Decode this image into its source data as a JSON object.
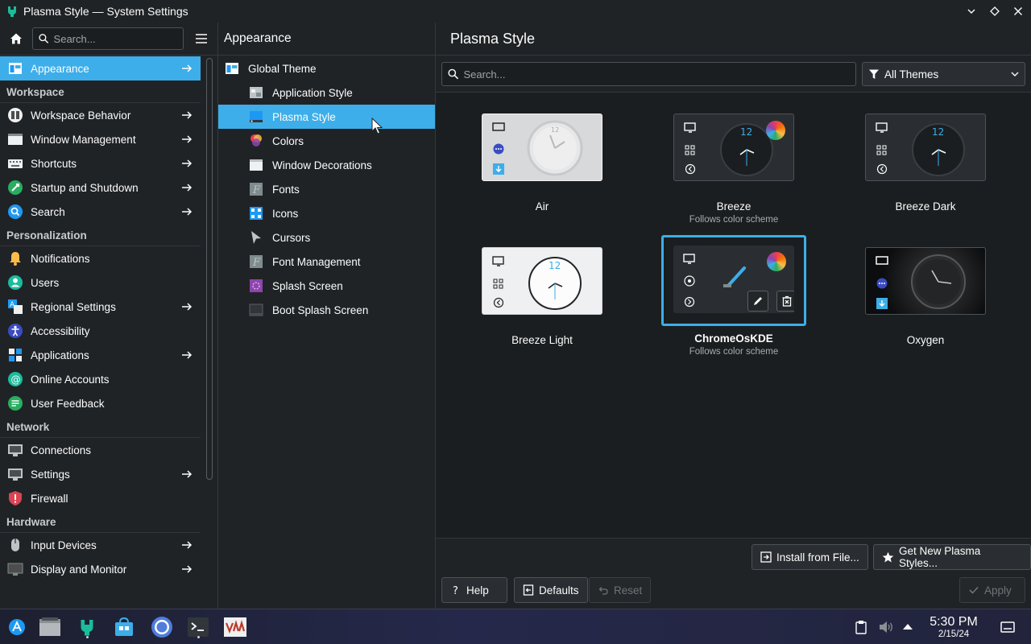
{
  "window": {
    "title": "Plasma Style — System Settings"
  },
  "sidebar": {
    "search_placeholder": "Search...",
    "active": {
      "label": "Appearance"
    },
    "sections": {
      "workspace": "Workspace",
      "personalization": "Personalization",
      "network": "Network",
      "hardware": "Hardware"
    },
    "workspace_items": [
      "Workspace Behavior",
      "Window Management",
      "Shortcuts",
      "Startup and Shutdown",
      "Search"
    ],
    "personalization_items": [
      "Notifications",
      "Users",
      "Regional Settings",
      "Accessibility",
      "Applications",
      "Online Accounts",
      "User Feedback"
    ],
    "network_items": [
      "Connections",
      "Settings",
      "Firewall"
    ],
    "hardware_items": [
      "Input Devices",
      "Display and Monitor"
    ]
  },
  "appearance": {
    "header": "Appearance",
    "items": [
      "Global Theme",
      "Application Style",
      "Plasma Style",
      "Colors",
      "Window Decorations",
      "Fonts",
      "Icons",
      "Cursors",
      "Font Management",
      "Splash Screen",
      "Boot Splash Screen"
    ]
  },
  "main": {
    "header": "Plasma Style",
    "search_placeholder": "Search...",
    "filter_label": "All Themes",
    "themes": [
      {
        "name": "Air",
        "sub": ""
      },
      {
        "name": "Breeze",
        "sub": "Follows color scheme"
      },
      {
        "name": "Breeze Dark",
        "sub": ""
      },
      {
        "name": "Breeze Light",
        "sub": ""
      },
      {
        "name": "ChromeOsKDE",
        "sub": "Follows color scheme"
      },
      {
        "name": "Oxygen",
        "sub": ""
      }
    ],
    "buttons": {
      "install": "Install from File...",
      "get_new": "Get New Plasma Styles...",
      "help": "Help",
      "defaults": "Defaults",
      "reset": "Reset",
      "apply": "Apply"
    }
  },
  "taskbar": {
    "time": "5:30 PM",
    "date": "2/15/24"
  },
  "colors": {
    "accent": "#3daee9",
    "background": "#202326"
  }
}
